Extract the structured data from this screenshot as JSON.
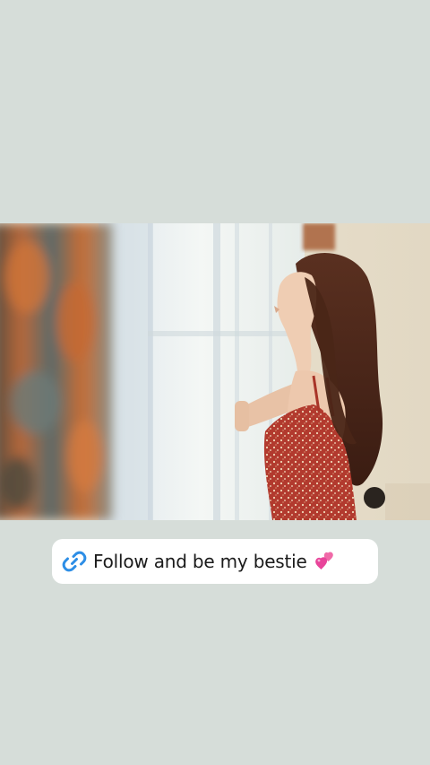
{
  "story": {
    "background_color": "#d6ddd9",
    "photo": {
      "alt": "photo"
    },
    "link_sticker": {
      "icon": "link-icon",
      "icon_color": "#2d8ee6",
      "text": "Follow and be my bestie",
      "emoji": "two-hearts-icon",
      "emoji_color": "#e8449a"
    }
  }
}
